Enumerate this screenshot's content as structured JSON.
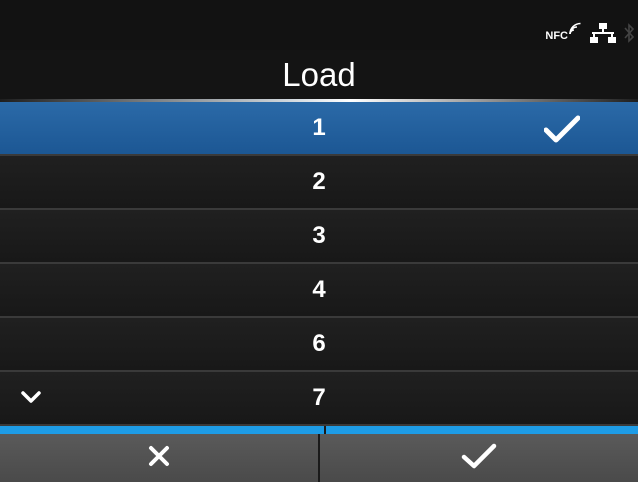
{
  "status": {
    "nfc_label": "NFC",
    "icons": [
      "nfc-icon",
      "network-icon",
      "bluetooth-icon"
    ]
  },
  "header": {
    "title": "Load"
  },
  "list": {
    "items": [
      {
        "label": "1",
        "selected": true
      },
      {
        "label": "2",
        "selected": false
      },
      {
        "label": "3",
        "selected": false
      },
      {
        "label": "4",
        "selected": false
      },
      {
        "label": "6",
        "selected": false
      },
      {
        "label": "7",
        "selected": false
      }
    ],
    "more_below_icon": "chevron-down-icon"
  },
  "footer": {
    "cancel_icon": "close-icon",
    "confirm_icon": "check-icon"
  },
  "colors": {
    "selection": "#2364a3",
    "accent": "#1e9ce6",
    "background": "#1a1a1a",
    "footer_button": "#525252"
  }
}
